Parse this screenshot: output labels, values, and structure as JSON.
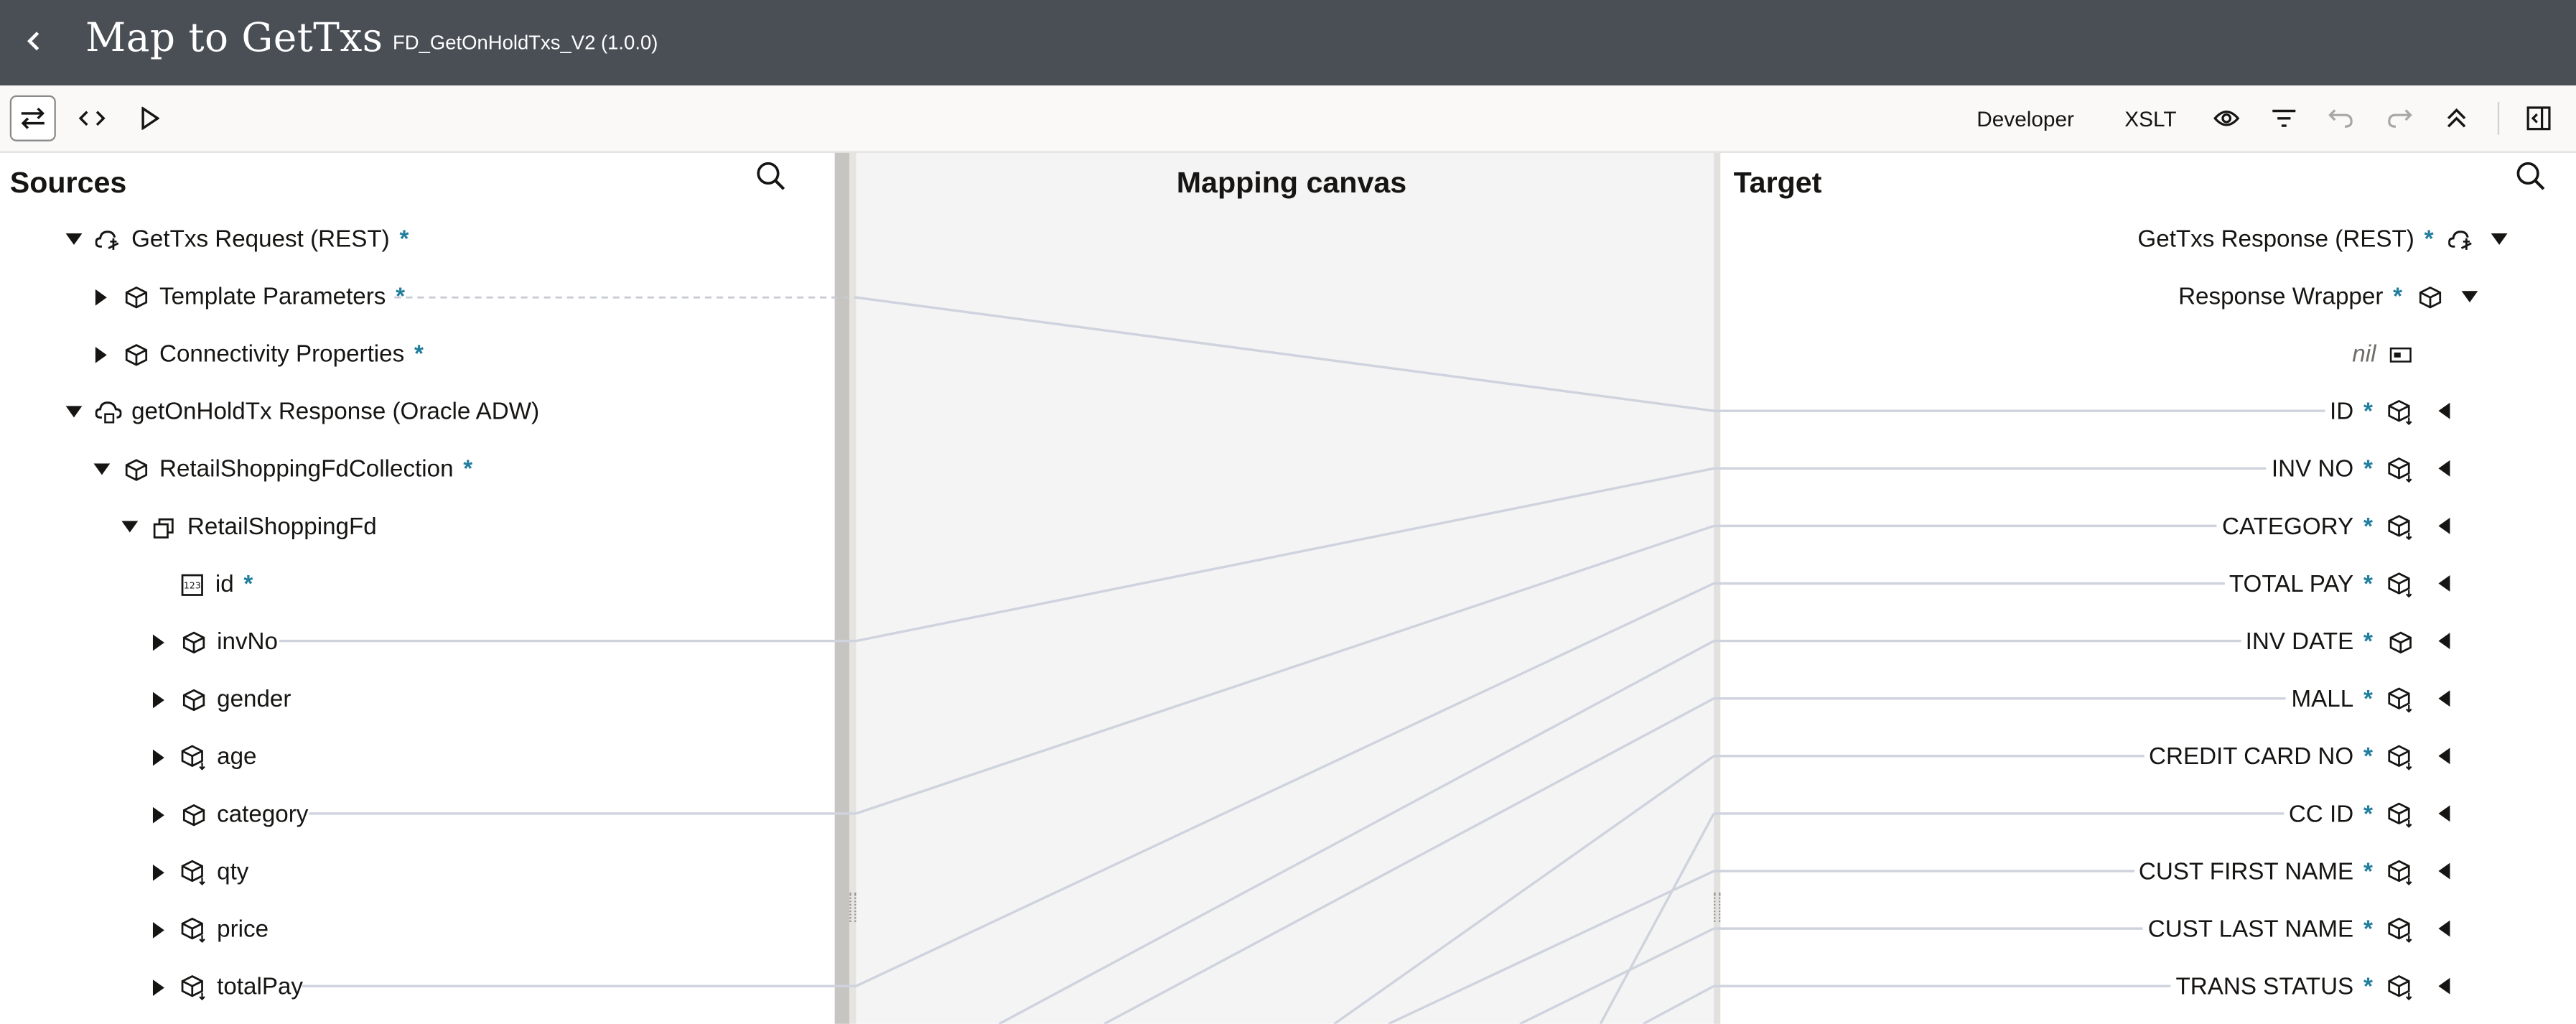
{
  "header": {
    "title": "Map to GetTxs",
    "subtitle": "FD_GetOnHoldTxs_V2 (1.0.0)",
    "back_icon": "chevron-left-icon"
  },
  "toolbar": {
    "left_icons": [
      "swap-icon",
      "code-icon",
      "play-icon"
    ],
    "developer_label": "Developer",
    "xslt_label": "XSLT",
    "right_icons": [
      "eye-icon",
      "filter-icon",
      "undo-icon",
      "redo-icon",
      "collapse-all-icon",
      "panel-toggle-icon"
    ]
  },
  "sources": {
    "heading": "Sources",
    "required_marker": "*",
    "items": [
      {
        "label": "GetTxs Request (REST)",
        "required": true,
        "expanded": true,
        "icon": "rest-cloud-icon"
      },
      {
        "label": "Template Parameters",
        "required": true,
        "expanded": false,
        "icon": "cube-icon"
      },
      {
        "label": "Connectivity Properties",
        "required": true,
        "expanded": false,
        "icon": "cube-icon"
      },
      {
        "label": "getOnHoldTx Response (Oracle ADW)",
        "required": false,
        "expanded": true,
        "icon": "database-cloud-icon"
      },
      {
        "label": "RetailShoppingFdCollection",
        "required": true,
        "expanded": true,
        "icon": "cube-icon"
      },
      {
        "label": "RetailShoppingFd",
        "required": false,
        "expanded": true,
        "icon": "repeating-element-icon"
      },
      {
        "label": "id",
        "required": true,
        "expanded": null,
        "icon": "number-field-icon"
      },
      {
        "label": "invNo",
        "required": false,
        "expanded": false,
        "icon": "cube-icon"
      },
      {
        "label": "gender",
        "required": false,
        "expanded": false,
        "icon": "cube-icon"
      },
      {
        "label": "age",
        "required": false,
        "expanded": false,
        "icon": "cube-optional-icon"
      },
      {
        "label": "category",
        "required": false,
        "expanded": false,
        "icon": "cube-icon"
      },
      {
        "label": "qty",
        "required": false,
        "expanded": false,
        "icon": "cube-optional-icon"
      },
      {
        "label": "price",
        "required": false,
        "expanded": false,
        "icon": "cube-optional-icon"
      },
      {
        "label": "totalPay",
        "required": false,
        "expanded": false,
        "icon": "cube-optional-icon"
      }
    ]
  },
  "canvas": {
    "heading": "Mapping canvas"
  },
  "target": {
    "heading": "Target",
    "items": [
      {
        "label": "GetTxs Response (REST)",
        "required": true,
        "icon": "rest-cloud-icon",
        "caret": "down"
      },
      {
        "label": "Response Wrapper",
        "required": true,
        "icon": "cube-icon",
        "caret": "down"
      },
      {
        "label": "nil",
        "required": false,
        "icon": "attribute-icon",
        "caret": null
      },
      {
        "label": "ID",
        "required": true,
        "icon": "cube-optional-icon",
        "caret": "left"
      },
      {
        "label": "INV NO",
        "required": true,
        "icon": "cube-optional-icon",
        "caret": "left"
      },
      {
        "label": "CATEGORY",
        "required": true,
        "icon": "cube-optional-icon",
        "caret": "left"
      },
      {
        "label": "TOTAL PAY",
        "required": true,
        "icon": "cube-optional-icon",
        "caret": "left"
      },
      {
        "label": "INV DATE",
        "required": true,
        "icon": "cube-icon",
        "caret": "left"
      },
      {
        "label": "MALL",
        "required": true,
        "icon": "cube-optional-icon",
        "caret": "left"
      },
      {
        "label": "CREDIT CARD NO",
        "required": true,
        "icon": "cube-optional-icon",
        "caret": "left"
      },
      {
        "label": "CC ID",
        "required": true,
        "icon": "cube-optional-icon",
        "caret": "left"
      },
      {
        "label": "CUST FIRST NAME",
        "required": true,
        "icon": "cube-optional-icon",
        "caret": "left"
      },
      {
        "label": "CUST LAST NAME",
        "required": true,
        "icon": "cube-optional-icon",
        "caret": "left"
      },
      {
        "label": "TRANS STATUS",
        "required": true,
        "icon": "cube-optional-icon",
        "caret": "left"
      }
    ]
  },
  "colors": {
    "header_bg": "#4a4f56",
    "required_marker": "#227e9e",
    "mapping_line": "#cfd3de",
    "canvas_bg": "#f4f4f4"
  }
}
